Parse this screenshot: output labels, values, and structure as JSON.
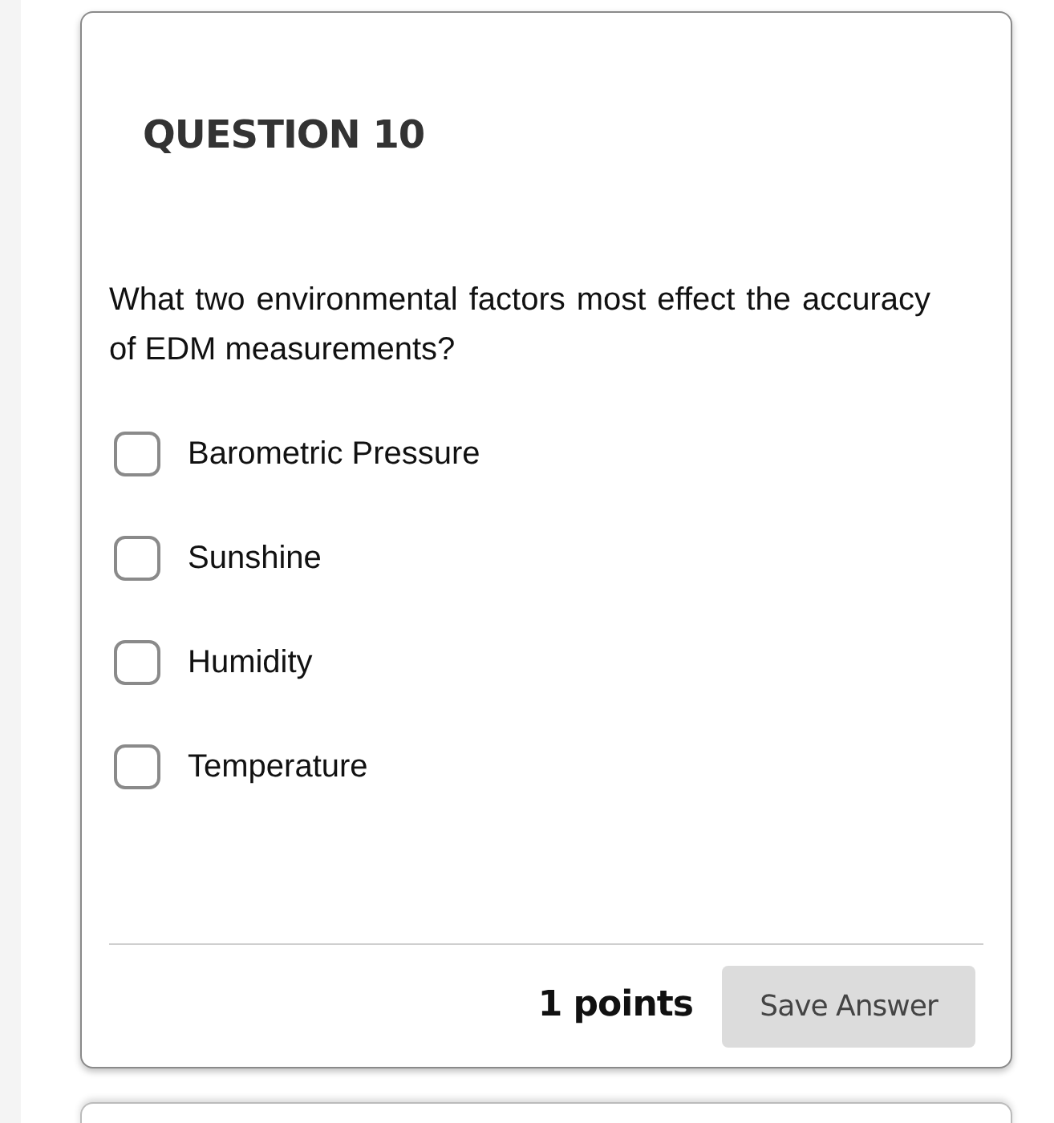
{
  "question": {
    "title": "QUESTION 10",
    "text": "What two environmental factors most effect the accuracy of EDM measurements?",
    "options": [
      {
        "label": "Barometric Pressure",
        "checked": false
      },
      {
        "label": "Sunshine",
        "checked": false
      },
      {
        "label": "Humidity",
        "checked": false
      },
      {
        "label": "Temperature",
        "checked": false
      }
    ],
    "points": "1 points",
    "save_button": "Save Answer"
  }
}
